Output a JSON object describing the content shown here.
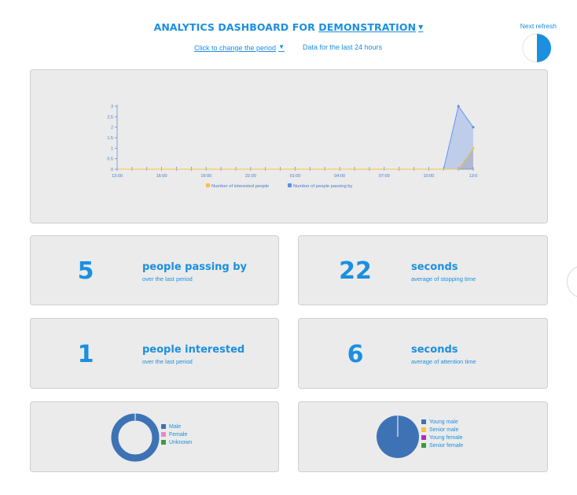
{
  "header": {
    "title_prefix": "ANALYTICS DASHBOARD FOR",
    "project_name": "DEMONSTRATION",
    "period_link": "Click to change the period",
    "period_info": "Data for the last 24 hours",
    "next_refresh_label": "Next refresh",
    "refresh_progress": 0.5
  },
  "chart_data": {
    "type": "area",
    "x": [
      "13:00",
      "14:00",
      "15:00",
      "16:00",
      "17:00",
      "18:00",
      "19:00",
      "20:00",
      "21:00",
      "22:00",
      "23:00",
      "00:00",
      "01:00",
      "02:00",
      "03:00",
      "04:00",
      "05:00",
      "06:00",
      "07:00",
      "08:00",
      "09:00",
      "10:00",
      "11:00",
      "12:00",
      "13:00"
    ],
    "xtick_labels": [
      "13:00",
      "16:00",
      "19:00",
      "22:00",
      "01:00",
      "04:00",
      "07:00",
      "10:00",
      "13:0"
    ],
    "yticks": [
      "3",
      "2.5",
      "2",
      "1.5",
      "1",
      "0.5",
      "0"
    ],
    "ylim": [
      0,
      3
    ],
    "series": [
      {
        "name": "Number of interested people",
        "color": "#f5c342",
        "values": [
          0,
          0,
          0,
          0,
          0,
          0,
          0,
          0,
          0,
          0,
          0,
          0,
          0,
          0,
          0,
          0,
          0,
          0,
          0,
          0,
          0,
          0,
          0,
          0,
          1
        ]
      },
      {
        "name": "Number of people passing by",
        "color": "#5b8ff0",
        "values": [
          0,
          0,
          0,
          0,
          0,
          0,
          0,
          0,
          0,
          0,
          0,
          0,
          0,
          0,
          0,
          0,
          0,
          0,
          0,
          0,
          0,
          0,
          0,
          3,
          2
        ]
      }
    ]
  },
  "stats": {
    "passing": {
      "value": "5",
      "title": "people passing by",
      "subtitle": "over the last period"
    },
    "stopping": {
      "value": "22",
      "title": "seconds",
      "subtitle": "average of stopping time"
    },
    "interested": {
      "value": "1",
      "title": "people interested",
      "subtitle": "over the last period"
    },
    "attention": {
      "value": "6",
      "title": "seconds",
      "subtitle": "average of attention time"
    }
  },
  "gender_chart": {
    "type": "donut",
    "legend": [
      {
        "label": "Male",
        "color": "#3d73b5",
        "value": 1
      },
      {
        "label": "Female",
        "color": "#e887c8",
        "value": 0
      },
      {
        "label": "Unknown",
        "color": "#3d9a3d",
        "value": 0
      }
    ]
  },
  "age_chart": {
    "type": "pie",
    "legend": [
      {
        "label": "Young male",
        "color": "#3d73b5",
        "value": 1
      },
      {
        "label": "Senior male",
        "color": "#f5c342",
        "value": 0
      },
      {
        "label": "Young female",
        "color": "#b02dbb",
        "value": 0
      },
      {
        "label": "Senior female",
        "color": "#3d9a3d",
        "value": 0
      }
    ]
  }
}
